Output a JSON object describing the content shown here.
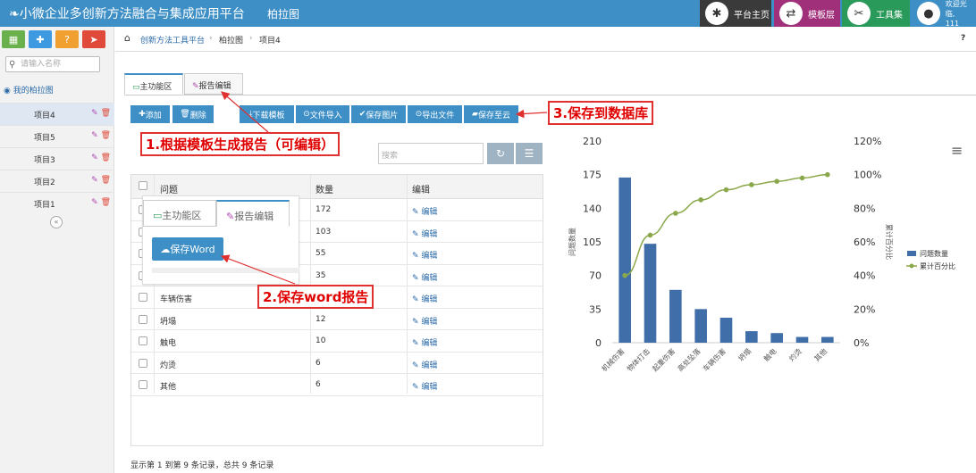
{
  "header": {
    "app_title": "小微企业多创新方法融合与集成应用平台",
    "page_name": "柏拉图",
    "nav": [
      {
        "label": "平台主页",
        "icon": "network-icon",
        "color": "#3a3a3a"
      },
      {
        "label": "模板层",
        "icon": "shuffle-icon",
        "color": "#a0307a"
      },
      {
        "label": "工具集",
        "icon": "tools-icon",
        "color": "#2a9a5a"
      }
    ],
    "welcome": "欢迎光临,",
    "user": "111"
  },
  "sidebar": {
    "search_placeholder": "请输入名称",
    "root": "我的柏拉图",
    "items": [
      "项目4",
      "项目5",
      "项目3",
      "项目2",
      "项目1"
    ]
  },
  "breadcrumb": [
    "创新方法工具平台",
    "柏拉图",
    "项目4"
  ],
  "tabs": [
    "主功能区",
    "报告编辑"
  ],
  "toolbar": {
    "add": "添加",
    "delete": "删除",
    "download_template": "下载模板",
    "import_file": "文件导入",
    "save_image": "保存图片",
    "export_file": "导出文件",
    "save_cloud": "保存至云"
  },
  "filter_placeholder": "搜索",
  "table": {
    "headers": [
      "问题",
      "数量",
      "编辑"
    ],
    "edit_label": "编辑",
    "rows": [
      {
        "problem": "",
        "count": "172"
      },
      {
        "problem": "",
        "count": "103"
      },
      {
        "problem": "",
        "count": "55"
      },
      {
        "problem": "高处坠落",
        "count": "35"
      },
      {
        "problem": "车辆伤害",
        "count": "26"
      },
      {
        "problem": "坍塌",
        "count": "12"
      },
      {
        "problem": "触电",
        "count": "10"
      },
      {
        "problem": "灼烫",
        "count": "6"
      },
      {
        "problem": "其他",
        "count": "6"
      }
    ]
  },
  "footer": "显示第 1 到第 9 条记录，总共 9 条记录",
  "popup": {
    "tabs": [
      "主功能区",
      "报告编辑"
    ],
    "save_word": "保存Word"
  },
  "annotations": {
    "a1": "1.根据模板生成报告（可编辑）",
    "a2": "2.保存word报告",
    "a3": "3.保存到数据库"
  },
  "chart_data": {
    "type": "bar",
    "categories": [
      "机械伤害",
      "物体打击",
      "起重伤害",
      "高处坠落",
      "车辆伤害",
      "坍塌",
      "触电",
      "灼烫",
      "其他"
    ],
    "series": [
      {
        "name": "问题数量",
        "type": "bar",
        "values": [
          172,
          103,
          55,
          35,
          26,
          12,
          10,
          6,
          6
        ],
        "color": "#3f6ea8"
      },
      {
        "name": "累计百分比",
        "type": "line",
        "values": [
          40,
          64,
          77,
          85,
          91,
          94,
          96,
          98,
          100
        ],
        "color": "#8aa84a"
      }
    ],
    "ylabel": "问题数量",
    "y2label": "累计百分比",
    "ylim": [
      0,
      210
    ],
    "y2lim": [
      0,
      120
    ],
    "yticks": [
      "0",
      "35",
      "70",
      "105",
      "140",
      "175",
      "210"
    ],
    "y2ticks": [
      "0%",
      "20%",
      "40%",
      "60%",
      "80%",
      "100%",
      "120%"
    ],
    "legend": "right"
  }
}
